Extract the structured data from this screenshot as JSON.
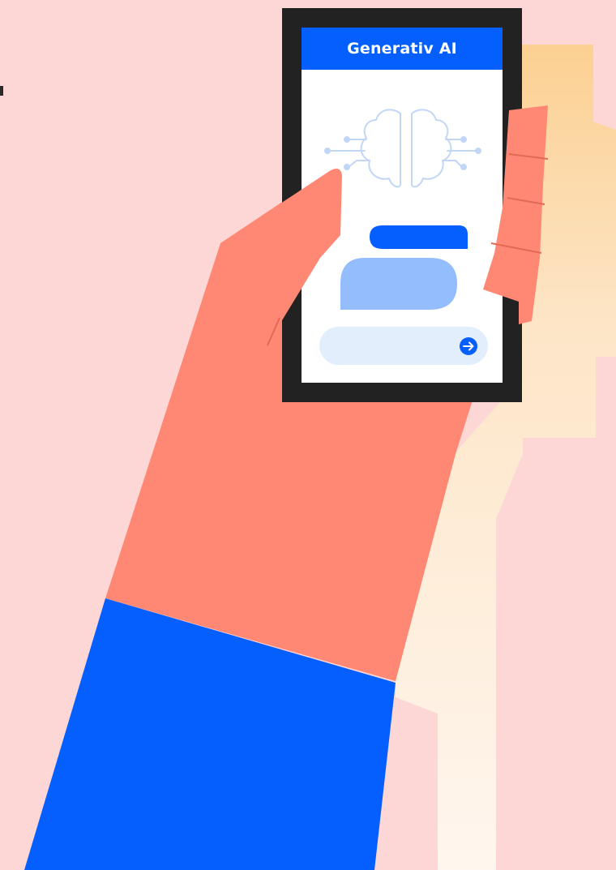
{
  "app": {
    "title": "Generativ AI"
  },
  "icons": {
    "brain": "brain-circuit-icon",
    "send": "arrow-right-icon"
  },
  "colors": {
    "background": "#fdd6d6",
    "accent_blue": "#045ffe",
    "bubble_light": "#94bdfd",
    "input_bg": "#e3eefd",
    "skin": "#fe8873",
    "phone_frame": "#222222",
    "shadow_cream": "#fde8c8"
  }
}
